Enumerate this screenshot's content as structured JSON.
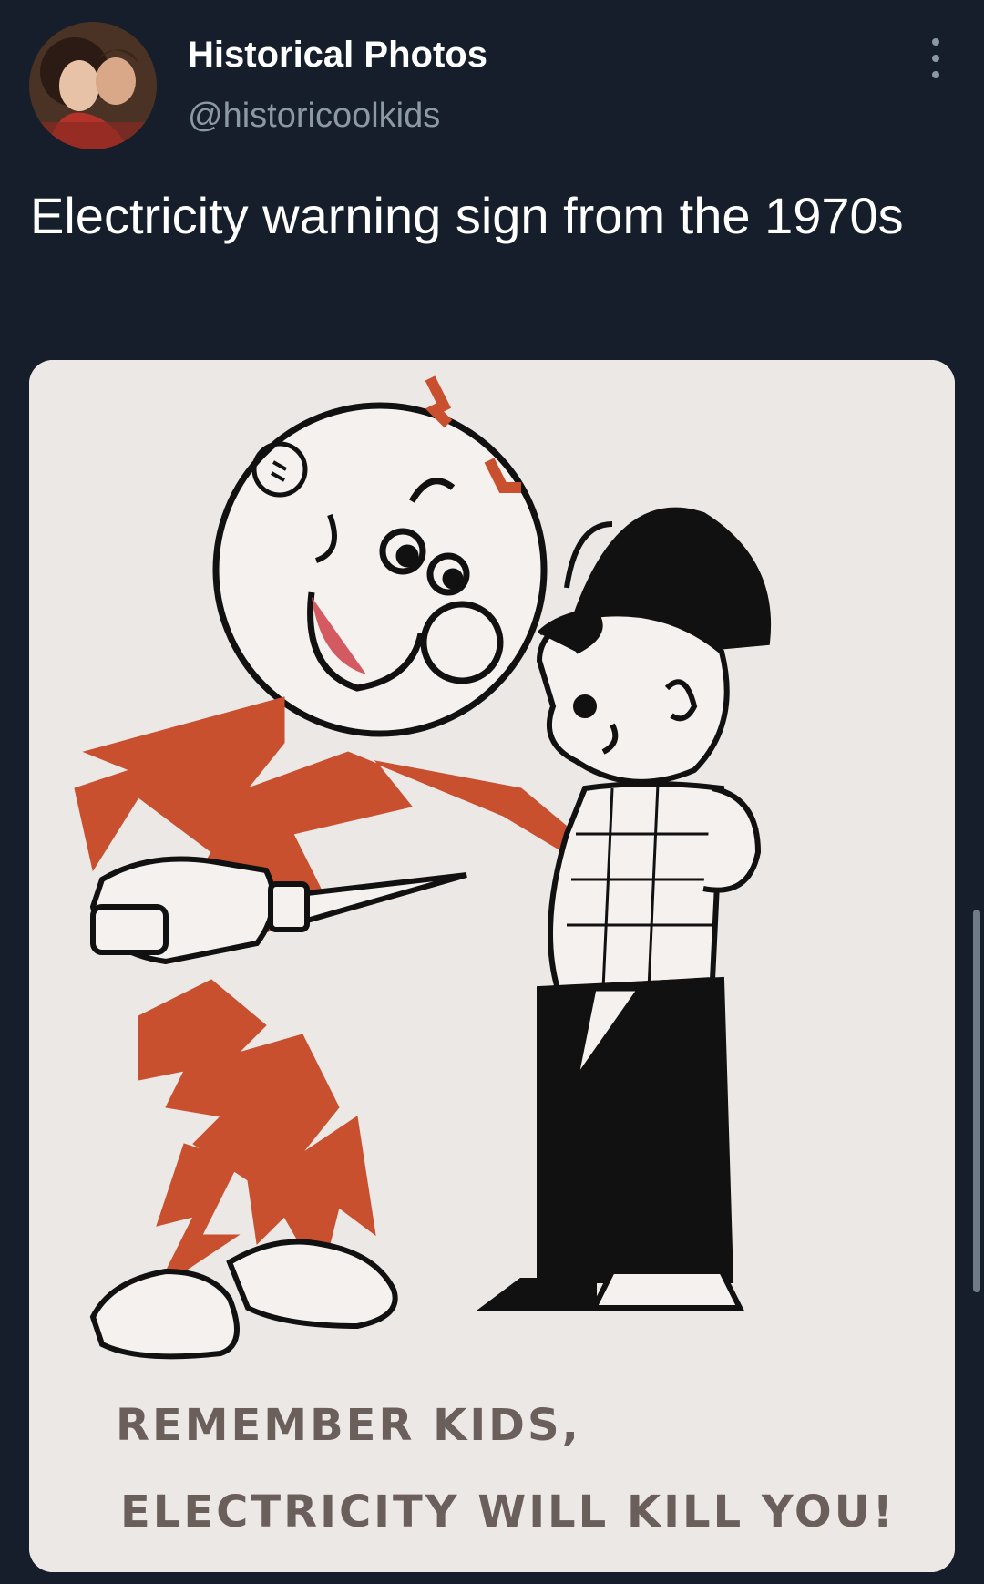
{
  "tweet": {
    "author_name": "Historical Photos",
    "author_handle": "@historicoolkids",
    "text": "Electricity warning sign from the 1970s",
    "more_icon": "more-vertical-icon"
  },
  "media": {
    "caption_line1": "REMEMBER KIDS,",
    "caption_line2": "ELECTRICITY WILL KILL YOU!",
    "colors": {
      "poster_background": "#ece8e6",
      "reddy_red": "#c8502f",
      "ink": "#111111"
    }
  }
}
